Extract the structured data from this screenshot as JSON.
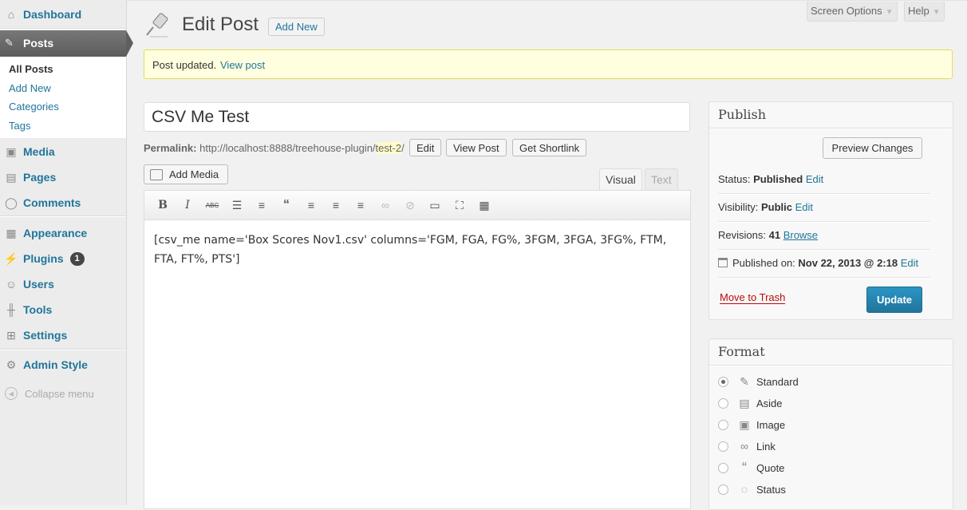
{
  "sidebar": {
    "dashboard": "Dashboard",
    "posts": "Posts",
    "submenu": [
      "All Posts",
      "Add New",
      "Categories",
      "Tags"
    ],
    "media": "Media",
    "pages": "Pages",
    "comments": "Comments",
    "appearance": "Appearance",
    "plugins": "Plugins",
    "plugins_badge": "1",
    "users": "Users",
    "tools": "Tools",
    "settings": "Settings",
    "admin_style": "Admin Style",
    "collapse": "Collapse menu"
  },
  "header": {
    "title": "Edit Post",
    "add_new": "Add New",
    "screen_options": "Screen Options",
    "help": "Help"
  },
  "notice": {
    "text": "Post updated.",
    "link": "View post"
  },
  "editor": {
    "title_value": "CSV Me Test",
    "permalink_label": "Permalink:",
    "permalink_base": "http://localhost:8888/treehouse-plugin/",
    "permalink_slug": "test-2",
    "permalink_end": "/",
    "edit_btn": "Edit",
    "view_post_btn": "View Post",
    "shortlink_btn": "Get Shortlink",
    "add_media": "Add Media",
    "tab_visual": "Visual",
    "tab_text": "Text",
    "content": "[csv_me name='Box Scores Nov1.csv' columns='FGM, FGA, FG%, 3FGM, 3FGA, 3FG%, FTM, FTA, FT%, PTS']"
  },
  "publish": {
    "heading": "Publish",
    "preview": "Preview Changes",
    "status_label": "Status:",
    "status_value": "Published",
    "visibility_label": "Visibility:",
    "visibility_value": "Public",
    "revisions_label": "Revisions:",
    "revisions_value": "41",
    "browse": "Browse",
    "published_label": "Published on:",
    "published_value": "Nov 22, 2013 @ 2:18",
    "edit": "Edit",
    "trash": "Move to Trash",
    "update": "Update"
  },
  "format": {
    "heading": "Format",
    "options": [
      "Standard",
      "Aside",
      "Image",
      "Link",
      "Quote",
      "Status"
    ],
    "selected": "Standard"
  }
}
